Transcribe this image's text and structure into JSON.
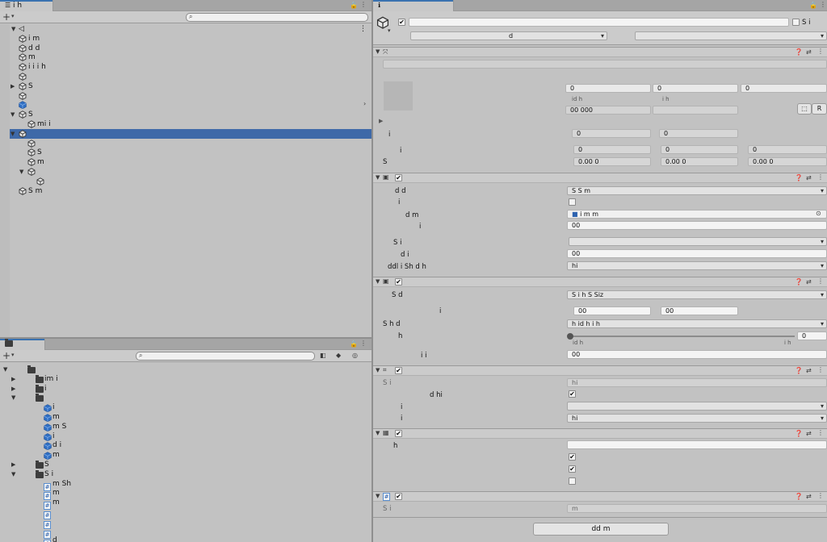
{
  "hierarchy": {
    "tab": "i       h",
    "search_placeholder": "",
    "rows": [
      {
        "id": "r0",
        "indent": 0,
        "label": "",
        "scene": true
      },
      {
        "id": "r1",
        "indent": 1,
        "label": "i      m"
      },
      {
        "id": "r2",
        "indent": 1,
        "label": "d                d"
      },
      {
        "id": "r3",
        "indent": 1,
        "label": "  m"
      },
      {
        "id": "r4",
        "indent": 1,
        "label": "i      i       i h"
      },
      {
        "id": "r5",
        "indent": 1,
        "label": ""
      },
      {
        "id": "r6",
        "indent": 1,
        "label": "S",
        "arrow": "▶"
      },
      {
        "id": "r7",
        "indent": 1,
        "label": ""
      },
      {
        "id": "r8",
        "indent": 1,
        "label": "",
        "blue": true
      },
      {
        "id": "r9",
        "indent": 1,
        "label": "S",
        "arrow": "▼"
      },
      {
        "id": "r10",
        "indent": 2,
        "label": "mi          i"
      },
      {
        "id": "r11",
        "indent": 1,
        "label": "",
        "arrow": "▼",
        "selected": true
      },
      {
        "id": "r12",
        "indent": 2,
        "label": ""
      },
      {
        "id": "r13",
        "indent": 2,
        "label": "           S"
      },
      {
        "id": "r14",
        "indent": 2,
        "label": "         m"
      },
      {
        "id": "r15",
        "indent": 2,
        "label": "",
        "arrow": "▼"
      },
      {
        "id": "r16",
        "indent": 3,
        "label": ""
      },
      {
        "id": "r17",
        "indent": 1,
        "label": "  S      m"
      }
    ]
  },
  "project": {
    "tab": "",
    "rows": [
      {
        "indent": 0,
        "label": "",
        "type": "folder",
        "arrow": "▼"
      },
      {
        "indent": 1,
        "label": "   im    i",
        "type": "folder",
        "arrow": "▶"
      },
      {
        "indent": 1,
        "label": "     i",
        "type": "folder",
        "arrow": "▶"
      },
      {
        "indent": 1,
        "label": "",
        "type": "folder",
        "arrow": "▼"
      },
      {
        "indent": 2,
        "label": "         i",
        "type": "blue"
      },
      {
        "indent": 2,
        "label": "     m",
        "type": "blue"
      },
      {
        "indent": 2,
        "label": "   m       S",
        "type": "blue"
      },
      {
        "indent": 2,
        "label": "           i",
        "type": "blue"
      },
      {
        "indent": 2,
        "label": "   d    i",
        "type": "blue"
      },
      {
        "indent": 2,
        "label": "           m",
        "type": "blue"
      },
      {
        "indent": 1,
        "label": "S",
        "type": "folder",
        "arrow": "▶"
      },
      {
        "indent": 1,
        "label": "S     i",
        "type": "folder",
        "arrow": "▼"
      },
      {
        "indent": 2,
        "label": "      m     Sh",
        "type": "script"
      },
      {
        "indent": 2,
        "label": "       m",
        "type": "script"
      },
      {
        "indent": 2,
        "label": "      m",
        "type": "script"
      },
      {
        "indent": 2,
        "label": "",
        "type": "script"
      },
      {
        "indent": 2,
        "label": "",
        "type": "script"
      },
      {
        "indent": 2,
        "label": "",
        "type": "script"
      },
      {
        "indent": 2,
        "label": "                          d",
        "type": "script"
      }
    ]
  },
  "inspector": {
    "static_label": "S      i",
    "layer_value": "d",
    "comp1": {
      "xyz": [
        "0",
        "0",
        "0"
      ],
      "sub": [
        "id h",
        "i  h"
      ],
      "val": "00 000",
      "btn": "R",
      "rows": [
        {
          "label": "i",
          "vals": [
            "0",
            "0"
          ]
        },
        {
          "label": "i",
          "vals": [
            "0",
            "0",
            "0"
          ]
        },
        {
          "label": "S",
          "vals": [
            "0.00  0",
            "0.00  0",
            "0.00  0"
          ]
        }
      ]
    },
    "comp2": {
      "rows": [
        {
          "label": "d        d",
          "type": "drop",
          "value": "S        S             m"
        },
        {
          "label": "i",
          "type": "check",
          "value": ""
        },
        {
          "label": "d        m",
          "type": "obj",
          "value": "    i        m         m"
        },
        {
          "label": "i",
          "type": "field",
          "value": "00"
        },
        {
          "label": "S     i",
          "type": "drop",
          "value": ""
        },
        {
          "label": "d     i",
          "type": "field",
          "value": "00"
        },
        {
          "label": "ddl i      Sh  d      h",
          "type": "drop",
          "value": "     hi"
        }
      ]
    },
    "comp3": {
      "rows": [
        {
          "label": "S          d",
          "type": "drop",
          "value": "S          i h S        Siz"
        },
        {
          "label": "i",
          "type": "pair",
          "value": [
            "00",
            "00"
          ]
        },
        {
          "label": "S                  h       d",
          "type": "drop",
          "value": "       h    id h           i h"
        },
        {
          "label": "h",
          "type": "slider",
          "value": "0",
          "min_label": "id h",
          "max_label": "i  h"
        },
        {
          "label": "i               i",
          "type": "field",
          "value": "00"
        }
      ]
    },
    "comp4": {
      "rows": [
        {
          "label": "S  i",
          "type": "obj_gray",
          "value": "      hi"
        },
        {
          "label": "d       hi",
          "type": "check",
          "value": "✔"
        },
        {
          "label": "i",
          "type": "drop",
          "value": ""
        },
        {
          "label": "i",
          "type": "drop",
          "value": "          hi"
        }
      ]
    },
    "comp5": {
      "rows": [
        {
          "label": "h",
          "type": "field",
          "value": ""
        },
        {
          "label": "",
          "type": "check",
          "value": "✔"
        },
        {
          "label": "",
          "type": "check",
          "value": "✔"
        },
        {
          "label": "",
          "type": "check",
          "value": ""
        }
      ]
    },
    "comp6": {
      "label": "S  i",
      "value": "   m"
    },
    "add_button": "dd     m"
  }
}
